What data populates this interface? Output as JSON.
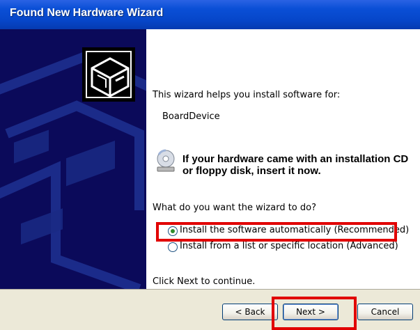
{
  "window": {
    "title": "Found New Hardware Wizard"
  },
  "content": {
    "intro": "This wizard helps you install software for:",
    "device": "BoardDevice",
    "cd_notice": "If your hardware came with an installation CD or floppy disk, insert it now.",
    "question": "What do you want the wizard to do?",
    "options": [
      {
        "label": "Install the software automatically (Recommended)",
        "checked": true
      },
      {
        "label": "Install from a list or specific location (Advanced)",
        "checked": false
      }
    ],
    "footer": "Click Next to continue."
  },
  "buttons": {
    "back": "< Back",
    "next": "Next >",
    "cancel": "Cancel"
  },
  "icons": {
    "banner": "hardware-install-icon",
    "cd": "cd-icon"
  },
  "colors": {
    "titlebar": "#0646c9",
    "banner": "#0b0a5a",
    "highlight": "#e10000",
    "bottom_bar": "#ece9d8"
  }
}
